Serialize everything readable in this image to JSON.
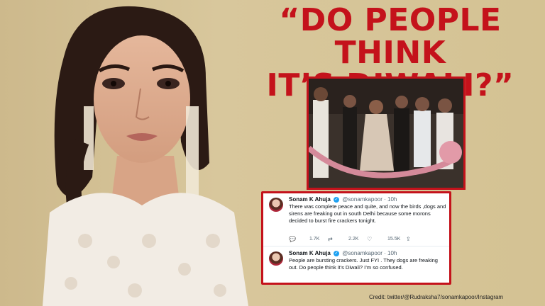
{
  "headline": {
    "line1": "“DO PEOPLE THINK",
    "line2": "IT’S DIWALI?”"
  },
  "tweets": [
    {
      "name": "Sonam K Ahuja",
      "handle": "@sonamkapoor",
      "time": "· 10h",
      "text": "There was complete peace and quite, and now the birds ,dogs and sirens are freaking out in south Delhi because some morons decided to burst fire crackers tonight.",
      "replies": "1.7K",
      "retweets": "2.2K",
      "likes": "15.5K"
    },
    {
      "name": "Sonam K Ahuja",
      "handle": "@sonamkapoor",
      "time": "· 10h",
      "text": "People are bursting crackers. Just FYI . They dogs are freaking out. Do people think it’s Diwali? I’m so confused."
    }
  ],
  "credit": "Credit: twitter/@Rudraksha7/sonamkapoor/Instagram",
  "colors": {
    "accent": "#c4121b",
    "background": "#d4c293"
  }
}
